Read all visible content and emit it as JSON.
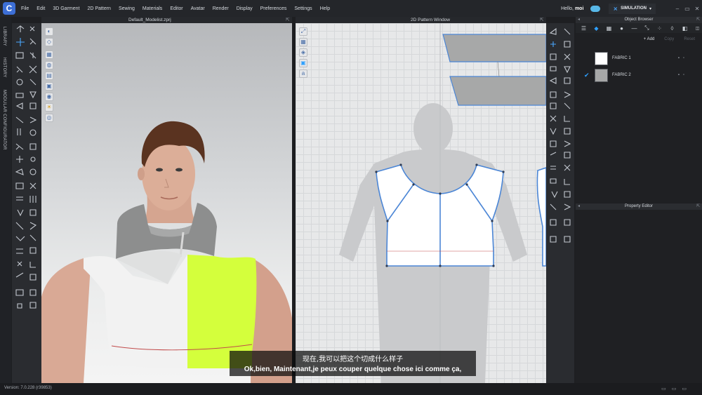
{
  "app": {
    "logo_letter": "C"
  },
  "menu": [
    "File",
    "Edit",
    "3D Garment",
    "2D Pattern",
    "Sewing",
    "Materials",
    "Editor",
    "Avatar",
    "Render",
    "Display",
    "Preferences",
    "Settings",
    "Help"
  ],
  "user": {
    "greeting": "Hello,",
    "name": "moi"
  },
  "simulation": {
    "label": "SIMULATION",
    "state_icon": "chevron-down"
  },
  "left_tabs": [
    "LIBRARY",
    "HISTORY",
    "MODULAR CONFIGURATOR"
  ],
  "viewport_3d": {
    "title": "Default_Modelist.zprj"
  },
  "viewport_2d": {
    "title": "2D Pattern Window"
  },
  "object_browser": {
    "title": "Object Browser",
    "add_label": "+ Add",
    "copy_label": "Copy",
    "reset_label": "Reset",
    "fabrics": [
      {
        "name": "FABRIC 1",
        "color": "#ffffff",
        "selected": false
      },
      {
        "name": "FABRIC 2",
        "color": "#a7a8a8",
        "selected": true
      }
    ]
  },
  "property_editor": {
    "title": "Property Editor"
  },
  "status": {
    "version": "Version: 7.0.228 (r39853)"
  },
  "subtitles": {
    "zh": "现在,我可以把这个切成什么样子",
    "fr": "Ok,bien, Maintenant,je peux couper quelque chose ici comme ça,"
  },
  "colors": {
    "accent": "#2ea0ff",
    "neon_fabric": "#d4ff3c",
    "collar": "#8d8e8e"
  }
}
